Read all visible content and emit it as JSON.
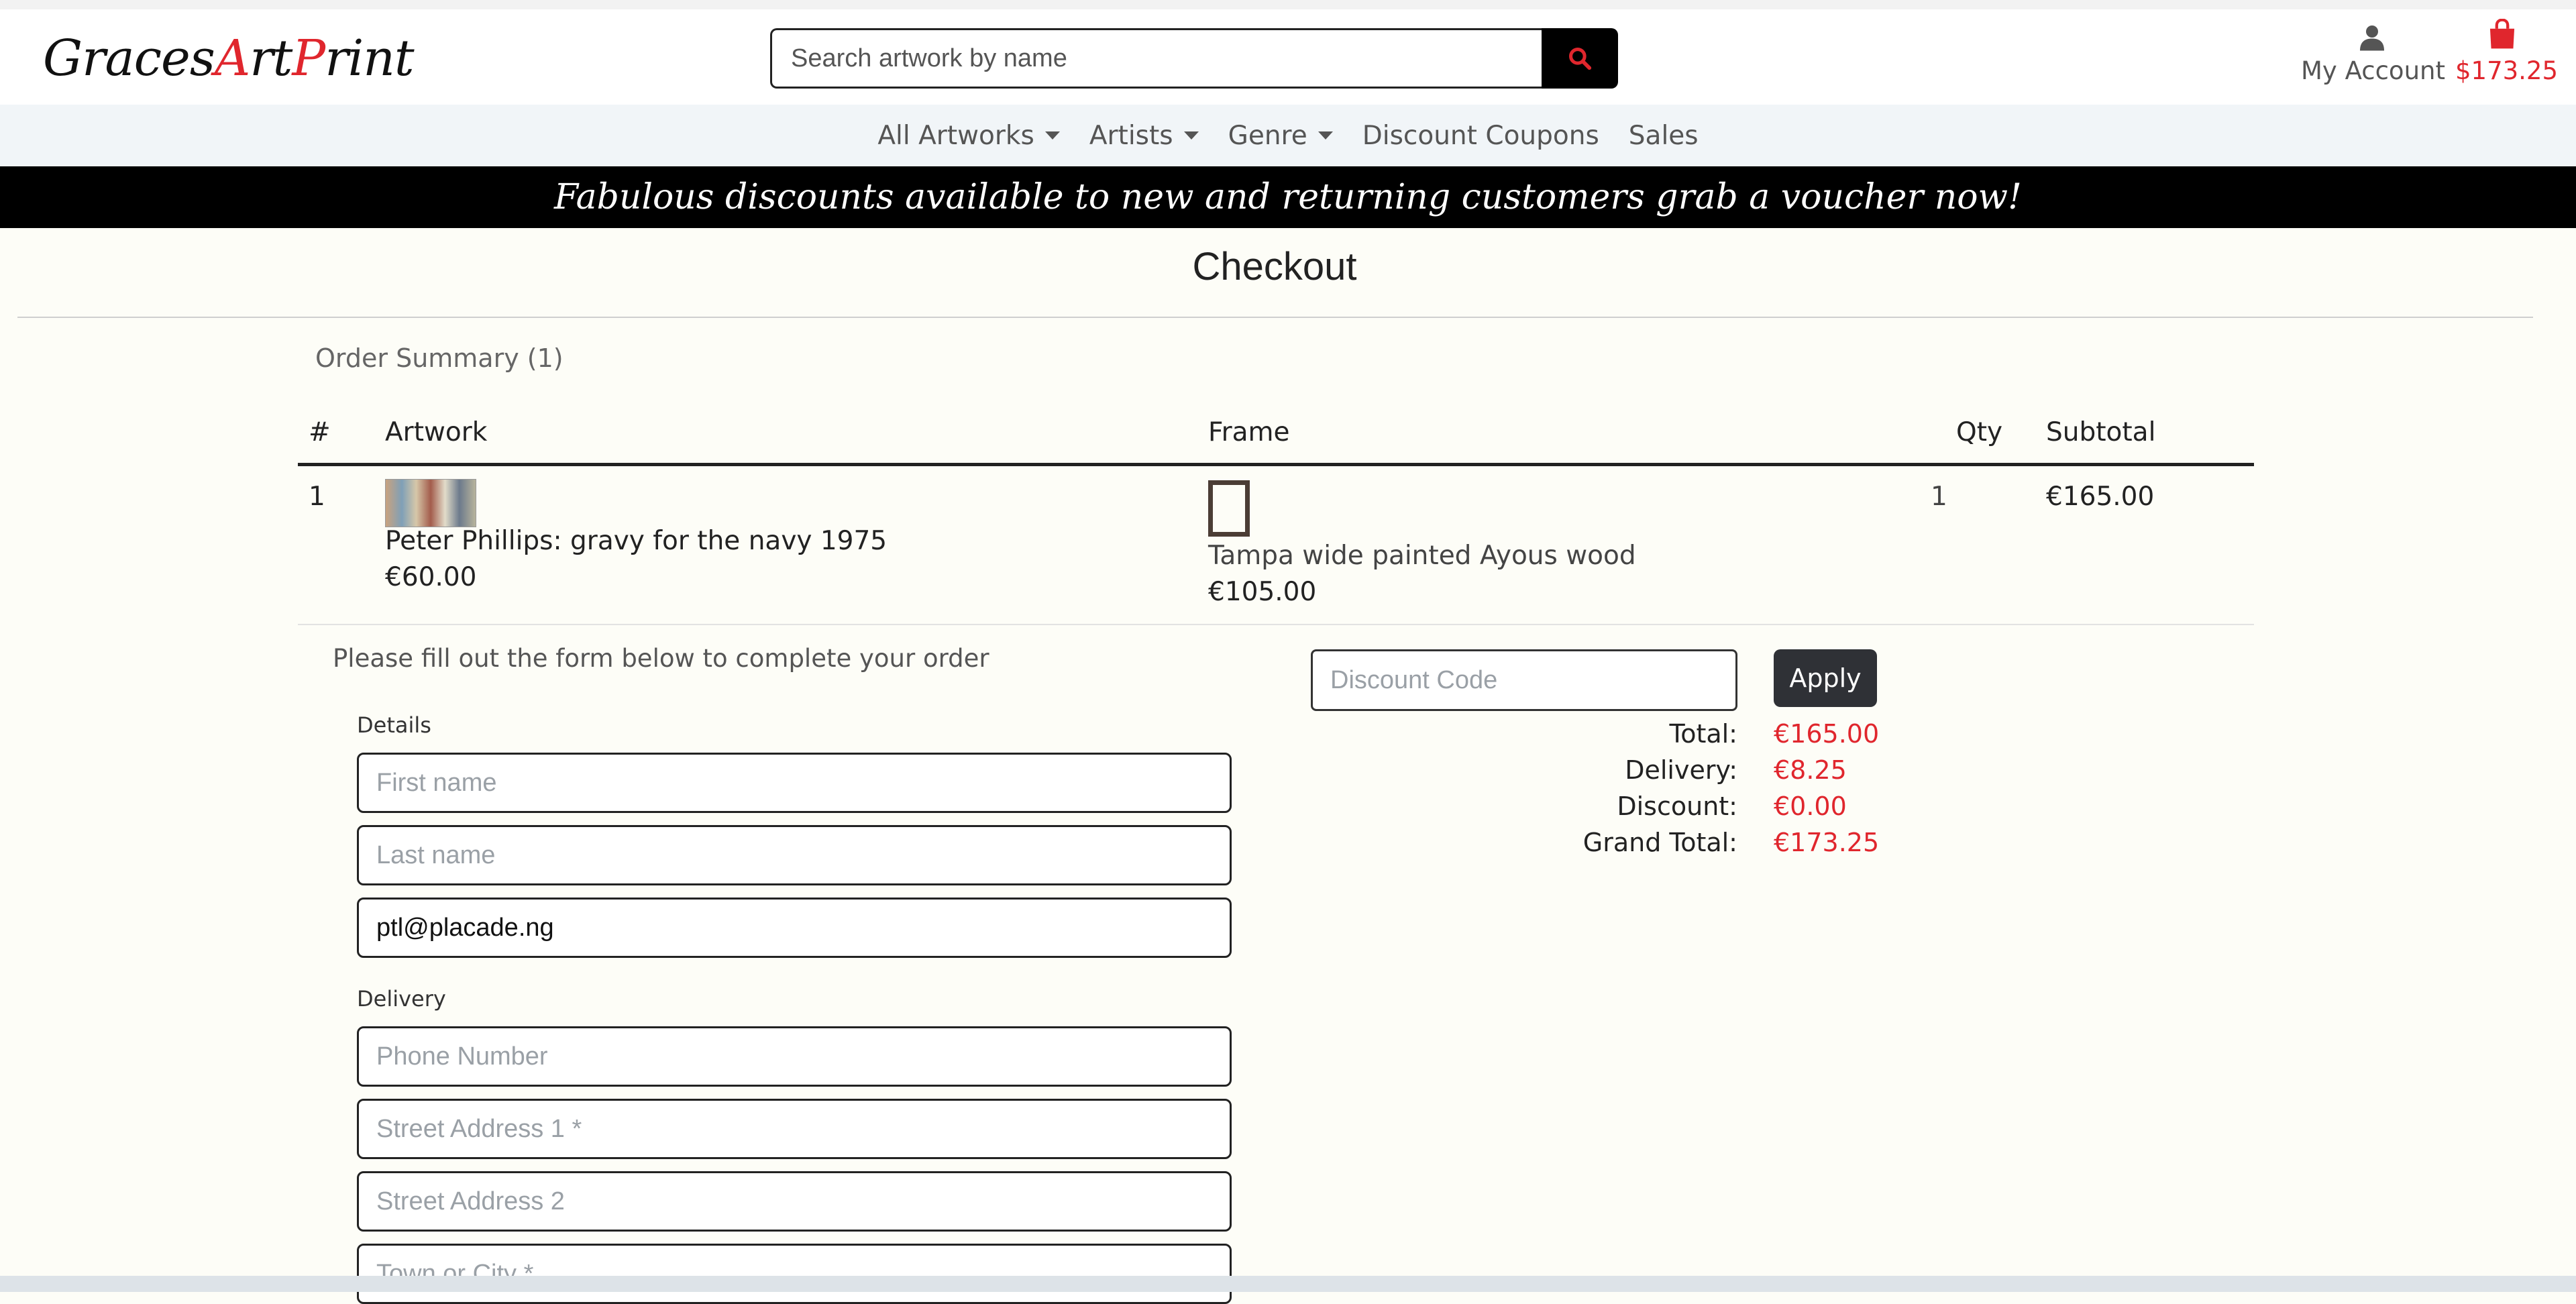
{
  "brand": {
    "logo_part1": "Graces",
    "logo_part2": "A",
    "logo_part3": "rt",
    "logo_part4": "P",
    "logo_part5": "rint",
    "accent_color": "#e0262d"
  },
  "search": {
    "placeholder": "Search artwork by name",
    "icon": "search-icon"
  },
  "account": {
    "label": "My Account",
    "icon": "user-icon"
  },
  "cart": {
    "total": "$173.25",
    "icon": "shopping-bag-icon"
  },
  "nav": {
    "items": [
      {
        "label": "All Artworks",
        "dropdown": true
      },
      {
        "label": "Artists",
        "dropdown": true
      },
      {
        "label": "Genre",
        "dropdown": true
      },
      {
        "label": "Discount Coupons",
        "dropdown": false
      },
      {
        "label": "Sales",
        "dropdown": false
      }
    ]
  },
  "banner": {
    "text": "Fabulous discounts available to new and returning customers grab a voucher now!"
  },
  "checkout": {
    "title": "Checkout",
    "summary_label": "Order Summary (1)",
    "table": {
      "headers": {
        "num": "#",
        "artwork": "Artwork",
        "frame": "Frame",
        "qty": "Qty",
        "subtotal": "Subtotal"
      },
      "rows": [
        {
          "num": "1",
          "artwork_name": "Peter Phillips: gravy for the navy 1975",
          "artwork_price": "€60.00",
          "frame_name": "Tampa wide painted Ayous wood",
          "frame_price": "€105.00",
          "qty": "1",
          "subtotal": "€165.00"
        }
      ]
    },
    "form": {
      "intro": "Please fill out the form below to complete your order",
      "details_label": "Details",
      "first_name_placeholder": "First name",
      "last_name_placeholder": "Last name",
      "email_value": "ptl@placade.ng",
      "delivery_label": "Delivery",
      "phone_placeholder": "Phone Number",
      "street1_placeholder": "Street Address 1 *",
      "street2_placeholder": "Street Address 2",
      "town_placeholder": "Town or City *"
    },
    "discount": {
      "placeholder": "Discount Code",
      "apply_label": "Apply"
    },
    "totals": {
      "total_label": "Total:",
      "total_value": "€165.00",
      "delivery_label": "Delivery:",
      "delivery_value": "€8.25",
      "discount_label": "Discount:",
      "discount_value": "€0.00",
      "grand_label": "Grand Total:",
      "grand_value": "€173.25"
    }
  }
}
